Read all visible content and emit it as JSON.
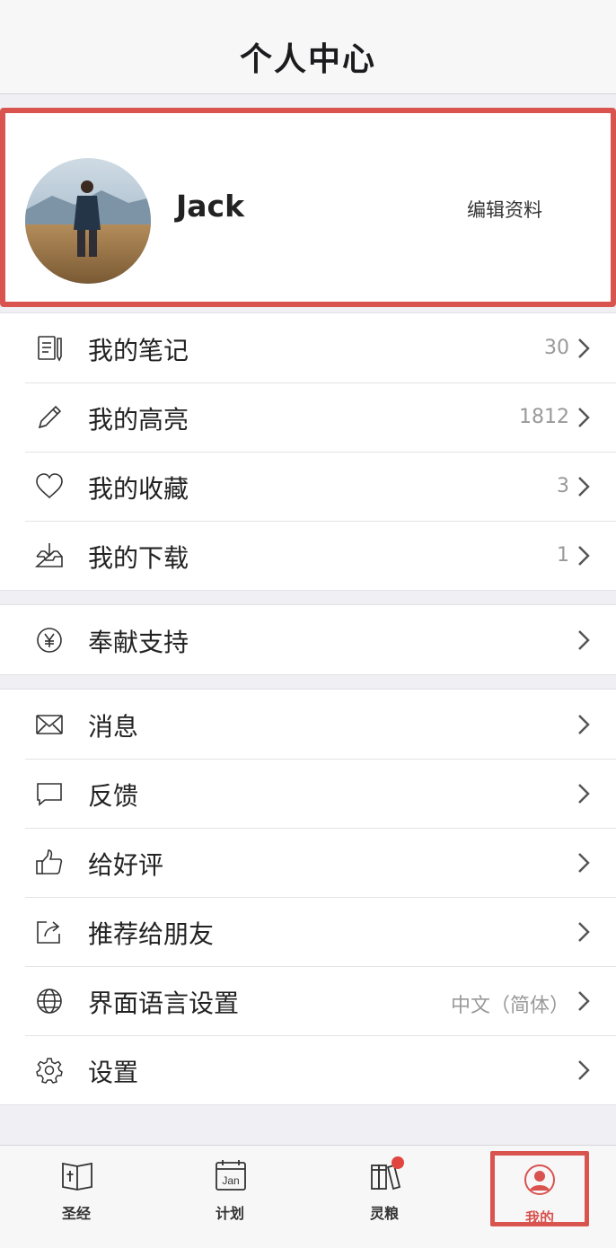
{
  "header": {
    "title": "个人中心"
  },
  "profile": {
    "name": "Jack",
    "edit_label": "编辑资料"
  },
  "group1": [
    {
      "icon": "notes-icon",
      "label": "我的笔记",
      "value": "30"
    },
    {
      "icon": "pencil-icon",
      "label": "我的高亮",
      "value": "1812"
    },
    {
      "icon": "heart-icon",
      "label": "我的收藏",
      "value": "3"
    },
    {
      "icon": "download-icon",
      "label": "我的下载",
      "value": "1"
    }
  ],
  "group2": [
    {
      "icon": "yen-icon",
      "label": "奉献支持",
      "value": ""
    }
  ],
  "group3": [
    {
      "icon": "mail-icon",
      "label": "消息",
      "value": ""
    },
    {
      "icon": "chat-bubble-icon",
      "label": "反馈",
      "value": ""
    },
    {
      "icon": "thumbs-up-icon",
      "label": "给好评",
      "value": ""
    },
    {
      "icon": "share-icon",
      "label": "推荐给朋友",
      "value": ""
    },
    {
      "icon": "globe-icon",
      "label": "界面语言设置",
      "value": "中文（简体）"
    },
    {
      "icon": "gear-icon",
      "label": "设置",
      "value": ""
    }
  ],
  "tabs": [
    {
      "icon": "bible-icon",
      "label": "圣经"
    },
    {
      "icon": "calendar-icon",
      "label": "计划",
      "icon_text": "Jan"
    },
    {
      "icon": "books-icon",
      "label": "灵粮"
    },
    {
      "icon": "user-icon",
      "label": "我的"
    }
  ],
  "colors": {
    "accent": "#d9534f",
    "badge": "#e0463f"
  }
}
